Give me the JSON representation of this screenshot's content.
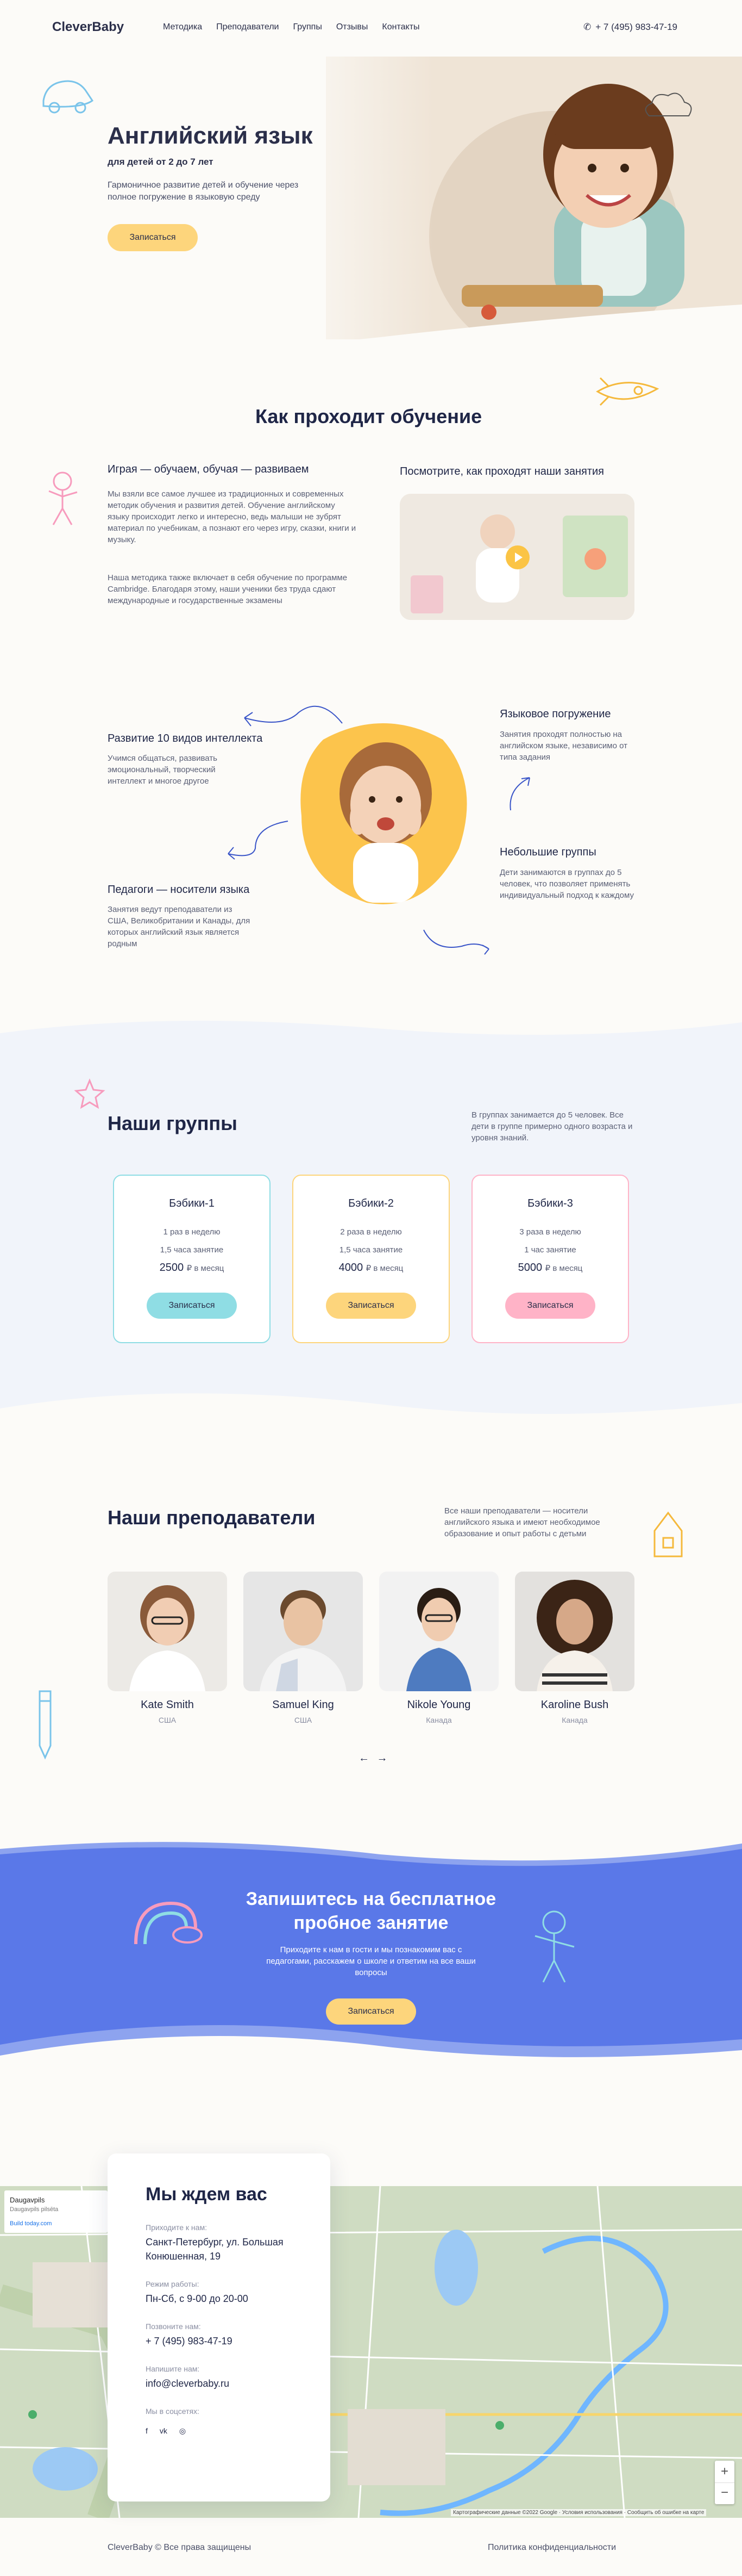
{
  "header": {
    "logo": "CleverBaby",
    "nav": [
      "Методика",
      "Преподаватели",
      "Группы",
      "Отзывы",
      "Контакты"
    ],
    "phone": "+ 7 (495) 983-47-19"
  },
  "hero": {
    "title": "Английский язык",
    "subtitle": "для детей от 2 до 7 лет",
    "description": "Гармоничное развитие детей и обучение через полное погружение в языковую среду",
    "button": "Записаться"
  },
  "how": {
    "title": "Как проходит обучение",
    "play_title": "Играя — обучаем, обучая — развиваем",
    "play_text_1": "Мы взяли все самое лучшее из традиционных и современных методик обучения и развития детей. Обучение английскому языку происходит легко и интересно, ведь малыши не зубрят материал по учебникам, а познают его через игру, сказки, книги и музыку.",
    "play_text_2": "Наша методика также включает в себя обучение по программе Cambridge. Благодаря этому, наши ученики без труда сдают международные и государственные экзамены",
    "video_title": "Посмотрите, как проходят наши занятия",
    "features": [
      {
        "title": "Развитие 10 видов интеллекта",
        "text": "Учимся общаться, развивать эмоциональный, творческий интеллект и многое другое"
      },
      {
        "title": "Педагоги — носители языка",
        "text": "Занятия ведут преподаватели из США, Великобритании и Канады, для которых английский язык является родным"
      },
      {
        "title": "Языковое погружение",
        "text": "Занятия проходят полностью на английском языке, независимо от типа задания"
      },
      {
        "title": "Небольшие группы",
        "text": "Дети занимаются в группах до 5 человек, что позволяет применять индивидуальный подход к каждому"
      }
    ]
  },
  "groups": {
    "title": "Наши группы",
    "note": "В группах занимается до 5 человек. Все дети в группе примерно одного возраста и уровня знаний.",
    "cards": [
      {
        "name": "Бэбики-1",
        "freq": "1 раз в неделю",
        "duration": "1,5 часа занятие",
        "price": "2500",
        "per": "₽ в месяц",
        "button": "Записаться",
        "color": "#8fdde4"
      },
      {
        "name": "Бэбики-2",
        "freq": "2 раза в неделю",
        "duration": "1,5 часа занятие",
        "price": "4000",
        "per": "₽ в месяц",
        "button": "Записаться",
        "color": "#fdd57c"
      },
      {
        "name": "Бэбики-3",
        "freq": "3 раза в неделю",
        "duration": "1 час занятие",
        "price": "5000",
        "per": "₽ в месяц",
        "button": "Записаться",
        "color": "#ffb3c7"
      }
    ]
  },
  "teachers": {
    "title": "Наши преподаватели",
    "note": "Все наши преподаватели — носители английского языка и имеют необходимое образование и опыт работы с детьми",
    "list": [
      {
        "name": "Kate Smith",
        "country": "США"
      },
      {
        "name": "Samuel King",
        "country": "США"
      },
      {
        "name": "Nikole Young",
        "country": "Канада"
      },
      {
        "name": "Karoline Bush",
        "country": "Канада"
      }
    ],
    "arrows": "← →"
  },
  "cta": {
    "title": "Запишитесь на бесплатное пробное занятие",
    "description": "Приходите к нам в гости и мы познакомим вас с педагогами, расскажем о школе и ответим на все ваши вопросы",
    "button": "Записаться"
  },
  "contacts": {
    "title": "Мы ждем вас",
    "address_label": "Приходите к нам:",
    "address": "Санкт-Петербург, ул. Большая Конюшенная, 19",
    "hours_label": "Режим работы:",
    "hours": "Пн-Сб, с 9-00 до 20-00",
    "phone_label": "Позвоните нам:",
    "phone": "+ 7 (495) 983-47-19",
    "email_label": "Напишите нам:",
    "email": "info@cleverbaby.ru",
    "social_label": "Мы в соцсетях:",
    "map_place": "Daugavpils",
    "map_place_sub": "Daugavpils pilsēta",
    "map_link": "Build today.com",
    "map_attribution": "Картографические данные ©2022 Google · Условия использования · Сообщить об ошибке на карте"
  },
  "footer": {
    "left": "CleverBaby © Все права защищены",
    "right": "Политика конфиденциальности"
  },
  "colors": {
    "accent_yellow": "#fdd57c",
    "accent_blue": "#5a78e8",
    "text_dark": "#1f2647"
  }
}
